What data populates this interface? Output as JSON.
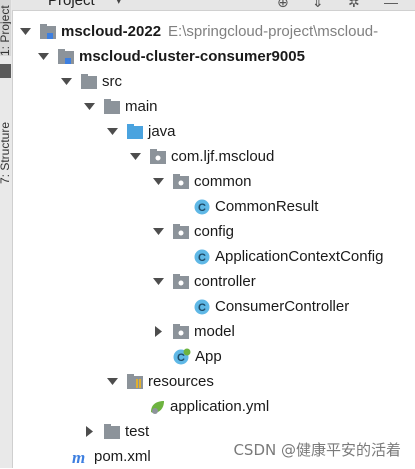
{
  "sidebar": {
    "project_tab": "1: Project",
    "structure_tab": "7: Structure"
  },
  "header": {
    "title": "Project"
  },
  "tree": {
    "root": {
      "label": "mscloud-2022",
      "path": "E:\\springcloud-project\\mscloud-"
    },
    "module": "mscloud-cluster-consumer9005",
    "src": "src",
    "main": "main",
    "java": "java",
    "package": "com.ljf.mscloud",
    "common": "common",
    "common_result": "CommonResult",
    "config": "config",
    "app_context_config": "ApplicationContextConfig",
    "controller": "controller",
    "consumer_controller": "ConsumerController",
    "model": "model",
    "app": "App",
    "resources": "resources",
    "application_yml": "application.yml",
    "test": "test",
    "pom": "pom.xml"
  },
  "watermark": "CSDN @健康平安的活着",
  "colors": {
    "folder": "#8c939a",
    "source_folder": "#4aa3df",
    "module_blue": "#3d7fe0",
    "class_circle": "#5fb8e6",
    "chevron": "#4d4d4d"
  }
}
